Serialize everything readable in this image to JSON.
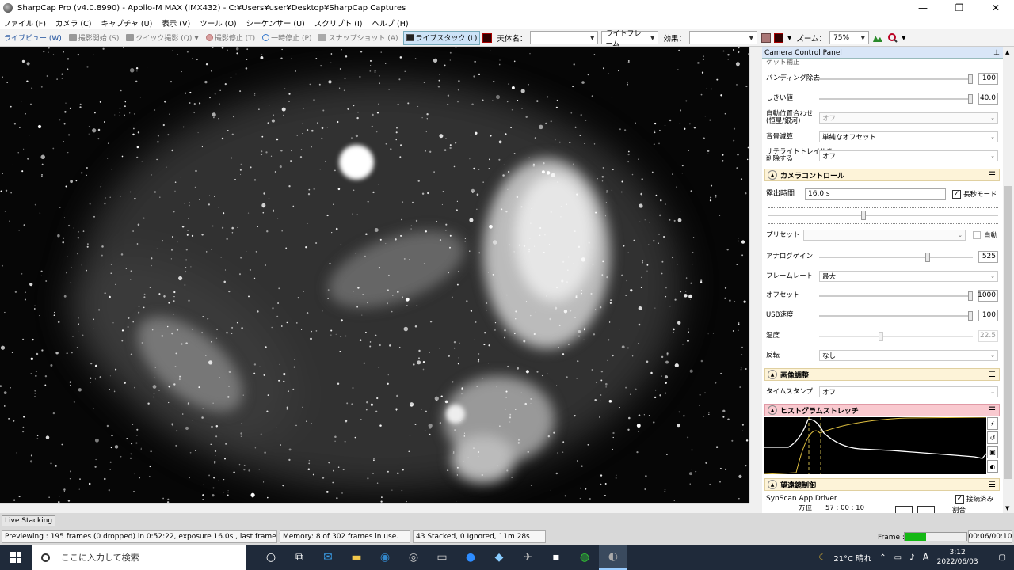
{
  "window": {
    "title": "SharpCap Pro (v4.0.8990) - Apollo-M MAX (IMX432) - C:¥Users¥user¥Desktop¥SharpCap Captures",
    "min": "—",
    "max": "❐",
    "close": "✕"
  },
  "menu": [
    "ファイル (F)",
    "カメラ (C)",
    "キャプチャ (U)",
    "表示 (V)",
    "ツール (O)",
    "シーケンサー (U)",
    "スクリプト (I)",
    "ヘルプ (H)"
  ],
  "toolbar": {
    "live_view": "ライブビュー (W)",
    "start_capture": "撮影開始 (S)",
    "quick_capture": "クイック撮影 (Q)",
    "stop_capture": "撮影停止 (T)",
    "pause": "一時停止 (P)",
    "snapshot": "スナップショット (A)",
    "live_stack": "ライブスタック (L)",
    "target_label": "天体名：",
    "target_value": "",
    "frame_type": "ライトフレーム",
    "effect_label": "効果：",
    "effect_value": "",
    "zoom_label": "ズーム：",
    "zoom_value": "75%"
  },
  "panel": {
    "title": "Camera Control Panel",
    "pin": "📌",
    "top_partial_label": "ケット補正",
    "banding_label": "バンディング除去",
    "banding_value": "100",
    "banding_level": 1.0,
    "threshold_label": "しきい値",
    "threshold_value": "40.0",
    "threshold_level": 1.0,
    "auto_align_label": "自動位置合わせ\n(恒星/銀河)",
    "auto_align_value": "オフ",
    "bg_sub_label": "背景減算",
    "bg_sub_value": "単純なオフセット",
    "sat_trail_label": "サテライトトレイルを\n削除する",
    "sat_trail_value": "オフ",
    "camera_section": "カメラコントロール",
    "exposure_label": "露出時間",
    "exposure_value": "16.0 s",
    "long_exposure_label": "長秒モード",
    "preset_label": "プリセット",
    "preset_value": "",
    "auto_label": "自動",
    "gain_label": "アナログゲイン",
    "gain_value": "525",
    "gain_level": 0.72,
    "framerate_label": "フレームレート",
    "framerate_value": "最大",
    "offset_label": "オフセット",
    "offset_value": "1000",
    "offset_level": 1.0,
    "usb_label": "USB速度",
    "usb_value": "100",
    "usb_level": 1.0,
    "temp_label": "温度",
    "temp_value": "22.5",
    "temp_level": 0.42,
    "flip_label": "反転",
    "flip_value": "なし",
    "image_section": "画像調整",
    "timestamp_label": "タイムスタンプ",
    "timestamp_value": "オフ",
    "histogram_section": "ヒストグラムストレッチ",
    "mount_section": "望遠鏡制御",
    "mount_driver": "SynScan App Driver",
    "connected_label": "接続済み",
    "azimuth_partial": "方位　　57 : 00 : 10",
    "ratio_partial": "割合"
  },
  "status": {
    "tab": "Live Stacking",
    "preview": "Previewing : 195 frames (0 dropped) in 0:52:22, exposure 16.0s , last frame 16.1s",
    "memory": "Memory: 8 of 302 frames in use.",
    "stacked": "43 Stacked, 0 Ignored, 11m 28s",
    "frame_label": "Frame :",
    "frame_progress": 0.35,
    "frame_time": "00:06/00:10"
  },
  "taskbar": {
    "search_placeholder": "ここに入力して検索",
    "weather": "21°C 晴れ",
    "ime": "A",
    "time": "3:12",
    "date": "2022/06/03"
  },
  "icons": {
    "pin": "pin-icon",
    "gear": "gear-icon"
  }
}
